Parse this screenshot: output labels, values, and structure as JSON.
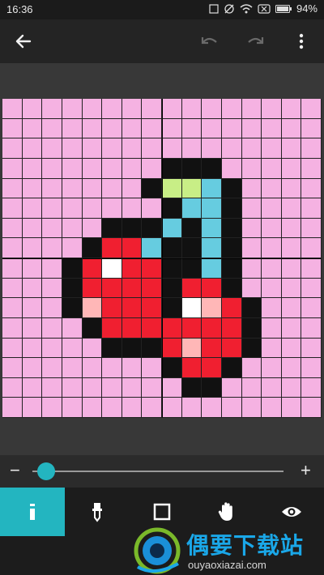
{
  "status_bar": {
    "time": "16:36",
    "battery": "94%",
    "icons": [
      "sim-icon",
      "sync-off-icon",
      "wifi-icon",
      "sim-x-icon",
      "battery-icon"
    ]
  },
  "toolbar": {
    "back_icon": "arrow-left-icon",
    "undo_icon": "undo-icon",
    "redo_icon": "redo-icon",
    "menu_icon": "more-vert-icon"
  },
  "canvas": {
    "cols": 16,
    "rows": 16,
    "palette": {
      ".": "#f5b2e2",
      "K": "#111111",
      "G": "#c8ee86",
      "C": "#66cce0",
      "R": "#f01f30",
      "W": "#ffffff",
      "P": "#ffb7b7"
    },
    "pixels": [
      "................",
      "................",
      "................",
      "........KKK.....",
      ".......KGGCK....",
      "........KCCK....",
      ".....KKKCKCK....",
      "....KRRCKKCK....",
      "...KRWRRKKCK....",
      "...KRRRRKRRK....",
      "...KPRRRKWPRK...",
      "....KRRRRRRRK...",
      ".....KKKRPRRK...",
      "........KRRK....",
      ".........KK.....",
      "................"
    ]
  },
  "zoom_slider": {
    "minus_label": "−",
    "plus_label": "+",
    "level": 0.03
  },
  "tools": [
    {
      "name": "pencil-icon",
      "active": true
    },
    {
      "name": "eyedropper-icon",
      "active": false
    },
    {
      "name": "square-icon",
      "active": false
    },
    {
      "name": "hand-icon",
      "active": false
    },
    {
      "name": "eye-icon",
      "active": false
    }
  ],
  "watermark": {
    "title": "偶要下载站",
    "url": "ouyaoxiazai.com"
  }
}
